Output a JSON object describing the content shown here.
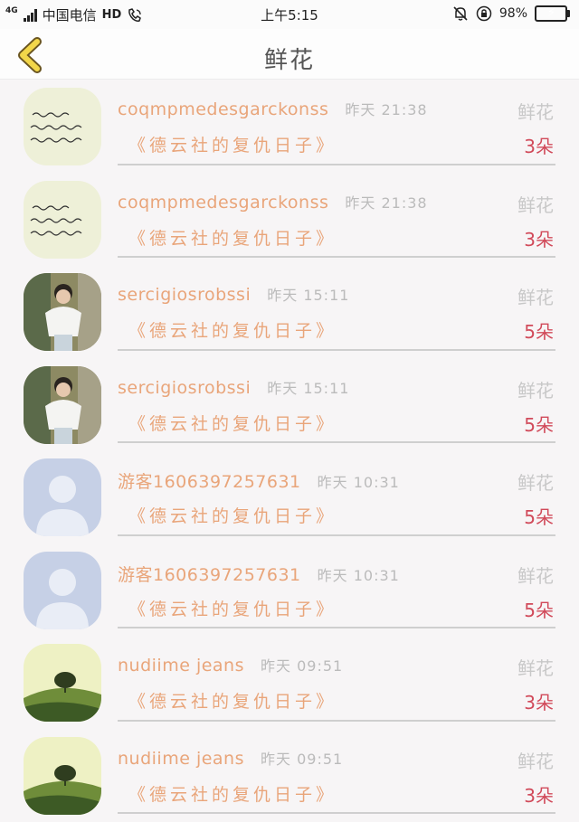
{
  "status_bar": {
    "network": "4G",
    "carrier": "中国电信",
    "hd_label": "HD",
    "time": "上午5:15",
    "battery": "98%",
    "battery_level": 0.98
  },
  "header": {
    "title": "鲜花"
  },
  "items": [
    {
      "name": "coqmpmedesgarckonss",
      "time": "昨天 21:38",
      "kind": "鲜花",
      "book": "《德云社的复仇日子》",
      "count": "3朵",
      "avatar": "handwriting-note"
    },
    {
      "name": "coqmpmedesgarckonss",
      "time": "昨天 21:38",
      "kind": "鲜花",
      "book": "《德云社的复仇日子》",
      "count": "3朵",
      "avatar": "handwriting-note"
    },
    {
      "name": "sercigiosrobssi",
      "time": "昨天 15:11",
      "kind": "鲜花",
      "book": "《德云社的复仇日子》",
      "count": "5朵",
      "avatar": "boy-photo"
    },
    {
      "name": "sercigiosrobssi",
      "time": "昨天 15:11",
      "kind": "鲜花",
      "book": "《德云社的复仇日子》",
      "count": "5朵",
      "avatar": "boy-photo"
    },
    {
      "name": "游客1606397257631",
      "time": "昨天 10:31",
      "kind": "鲜花",
      "book": "《德云社的复仇日子》",
      "count": "5朵",
      "avatar": "default-user"
    },
    {
      "name": "游客1606397257631",
      "time": "昨天 10:31",
      "kind": "鲜花",
      "book": "《德云社的复仇日子》",
      "count": "5朵",
      "avatar": "default-user"
    },
    {
      "name": "nudiime jeans",
      "time": "昨天 09:51",
      "kind": "鲜花",
      "book": "《德云社的复仇日子》",
      "count": "3朵",
      "avatar": "hill-tree"
    },
    {
      "name": "nudiime jeans",
      "time": "昨天 09:51",
      "kind": "鲜花",
      "book": "《德云社的复仇日子》",
      "count": "3朵",
      "avatar": "hill-tree"
    }
  ]
}
